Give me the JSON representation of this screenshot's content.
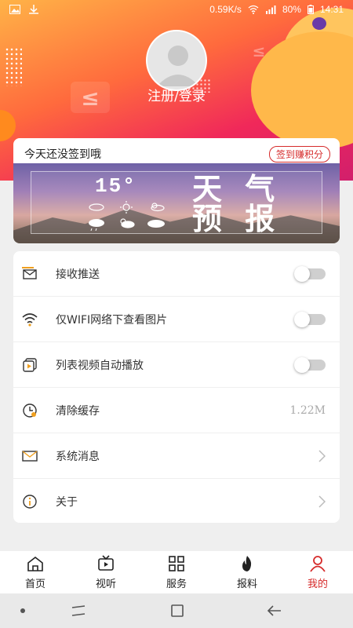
{
  "status_bar": {
    "speed": "0.59K/s",
    "battery": "80%",
    "time": "14:31"
  },
  "profile": {
    "login_label": "注册/登录"
  },
  "checkin": {
    "prompt": "今天还没签到哦",
    "badge": "签到赚积分"
  },
  "weather_banner": {
    "temperature": "15°",
    "title": "天 气 预 报"
  },
  "settings": [
    {
      "icon": "envelope-plane-icon",
      "label": "接收推送",
      "control": "toggle",
      "on": false
    },
    {
      "icon": "wifi-icon",
      "label": "仅WIFI网络下查看图片",
      "control": "toggle",
      "on": false
    },
    {
      "icon": "video-list-icon",
      "label": "列表视频自动播放",
      "control": "toggle",
      "on": false
    },
    {
      "icon": "clock-clear-icon",
      "label": "清除缓存",
      "control": "value",
      "value": "1.22M"
    },
    {
      "icon": "mail-icon",
      "label": "系统消息",
      "control": "chevron"
    },
    {
      "icon": "info-icon",
      "label": "关于",
      "control": "chevron"
    }
  ],
  "bottom_nav": [
    {
      "icon": "home-icon",
      "label": "首页",
      "active": false
    },
    {
      "icon": "tv-icon",
      "label": "视听",
      "active": false
    },
    {
      "icon": "grid-icon",
      "label": "服务",
      "active": false
    },
    {
      "icon": "fire-icon",
      "label": "报料",
      "active": false
    },
    {
      "icon": "person-icon",
      "label": "我的",
      "active": true
    }
  ],
  "colors": {
    "accent": "#d62b2b",
    "header_orange": "#ff6a3d",
    "header_pink": "#d21f6c"
  }
}
